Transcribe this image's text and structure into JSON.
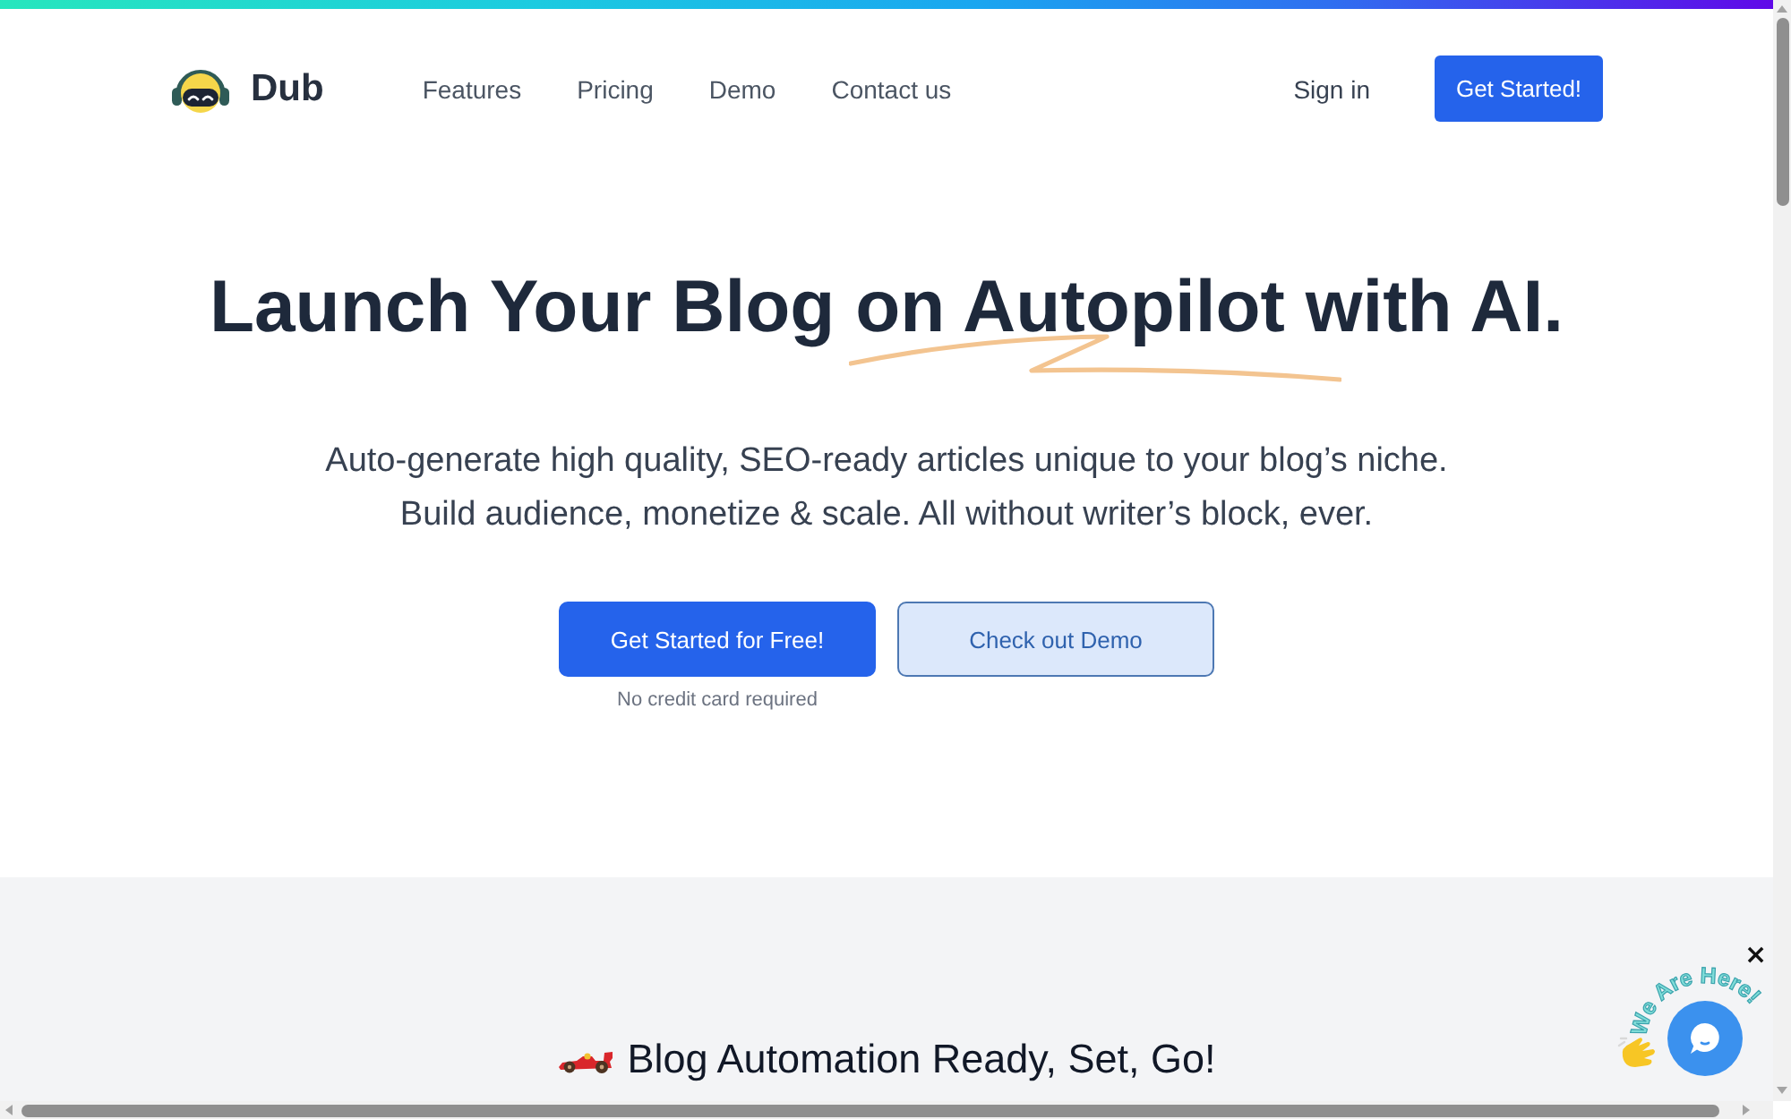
{
  "nav": {
    "brand": "Dub",
    "links": [
      "Features",
      "Pricing",
      "Demo",
      "Contact us"
    ],
    "sign_in": "Sign in",
    "cta": "Get Started!"
  },
  "hero": {
    "headline": "Launch Your Blog on Autopilot with AI.",
    "subtitle": "Auto-generate high quality, SEO-ready articles unique to your blog’s niche.\nBuild audience, monetize & scale. All without writer’s block, ever.",
    "buttons": [
      {
        "kind": "primary",
        "label": "Get Started for Free!",
        "note": "No credit card required"
      },
      {
        "kind": "secondary",
        "label": "Check out Demo"
      }
    ]
  },
  "section": {
    "heading": "Blog Automation Ready, Set, Go!"
  },
  "chat_widget": {
    "greeting": "We Are Here!",
    "close": "×"
  }
}
